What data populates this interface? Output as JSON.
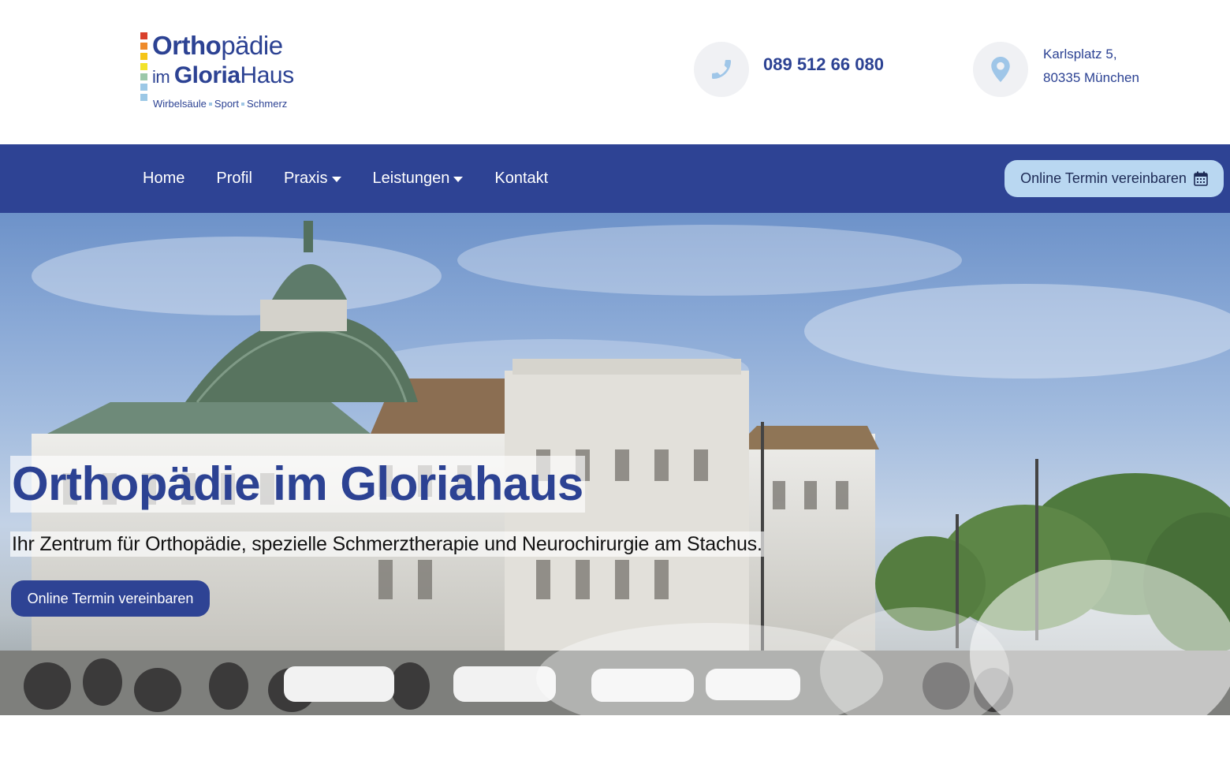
{
  "logo": {
    "line1_bold": "Ortho",
    "line1_rest": "pädie",
    "line2_small": "im ",
    "line2_bold": "Gloria",
    "line2_rest": "Haus",
    "tagline": [
      "Wirbelsäule",
      "Sport",
      "Schmerz"
    ],
    "bar_colors": [
      "#d9402b",
      "#ee8a2a",
      "#f5c518",
      "#f2e32a",
      "#9cc8a9",
      "#9cc8e6"
    ]
  },
  "contact": {
    "phone": "089 512 66 080",
    "phone_icon": "phone-icon",
    "address_line1": "Karlsplatz 5,",
    "address_line2": "80335 München",
    "location_icon": "map-marker-icon"
  },
  "nav": {
    "items": [
      {
        "label": "Home",
        "dropdown": false
      },
      {
        "label": "Profil",
        "dropdown": false
      },
      {
        "label": "Praxis",
        "dropdown": true
      },
      {
        "label": "Leistungen",
        "dropdown": true
      },
      {
        "label": "Kontakt",
        "dropdown": false
      }
    ],
    "cta_label": "Online Termin vereinbaren",
    "cta_icon": "calendar-icon"
  },
  "hero": {
    "title": "Orthopädie im Gloriahaus",
    "subtitle": "Ihr Zentrum für Orthopädie, spezielle Schmerztherapie und Neurochirurgie am Stachus.",
    "cta_label": "Online Termin vereinbaren"
  },
  "colors": {
    "brand_blue": "#2e4394",
    "text_blue": "#2c4293",
    "light_blue": "#b9d7f1",
    "icon_blue": "#9fc6e8"
  }
}
